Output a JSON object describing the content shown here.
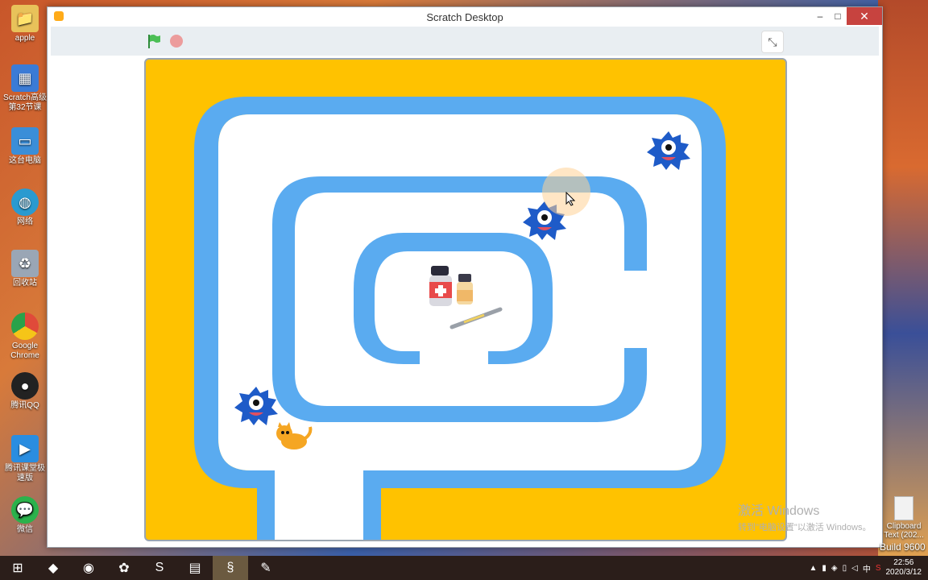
{
  "desktop": {
    "icons": [
      {
        "label": "apple",
        "icon": "folder-icon",
        "color": "#e8c25a"
      },
      {
        "label": "Scratch高级第32节课",
        "icon": "archive-icon",
        "color": "#3b7bd6"
      },
      {
        "label": "这台电脑",
        "icon": "computer-icon",
        "color": "#3a8ed8"
      },
      {
        "label": "网络",
        "icon": "network-icon",
        "color": "#2a9ad0"
      },
      {
        "label": "回收站",
        "icon": "recycle-bin-icon",
        "color": "#9aa6b5"
      },
      {
        "label": "Google Chrome",
        "icon": "chrome-icon",
        "color": "#e04a3a"
      },
      {
        "label": "腾讯QQ",
        "icon": "qq-icon",
        "color": "#222222"
      },
      {
        "label": "腾讯课堂极速版",
        "icon": "tencent-class-icon",
        "color": "#2a8de0"
      },
      {
        "label": "微信",
        "icon": "wechat-icon",
        "color": "#2bb24c"
      }
    ],
    "right_file_label": "Clipboard Text (202...",
    "watermark_title": "激活 Windows",
    "watermark_sub": "转到\"电脑设置\"以激活 Windows。",
    "build_text": "Build 9600"
  },
  "window": {
    "title": "Scratch Desktop",
    "minimize": "–",
    "maximize": "□",
    "close": "✕"
  },
  "toolbar": {
    "green_flag": "green-flag-icon",
    "stop": "stop-icon",
    "exit_fullscreen": "⤡"
  },
  "stage": {
    "background_color": "#ffc200",
    "wall_color": "#5aabf0",
    "path_color": "#ffffff"
  },
  "taskbar": {
    "items": [
      "windows-start-icon",
      "app-icon",
      "chrome-icon",
      "app2-icon",
      "sogou-icon",
      "file-explorer-icon",
      "scratch-icon",
      "tool-icon"
    ],
    "time": "22:56",
    "date": "2020/3/12",
    "ime": "中"
  }
}
